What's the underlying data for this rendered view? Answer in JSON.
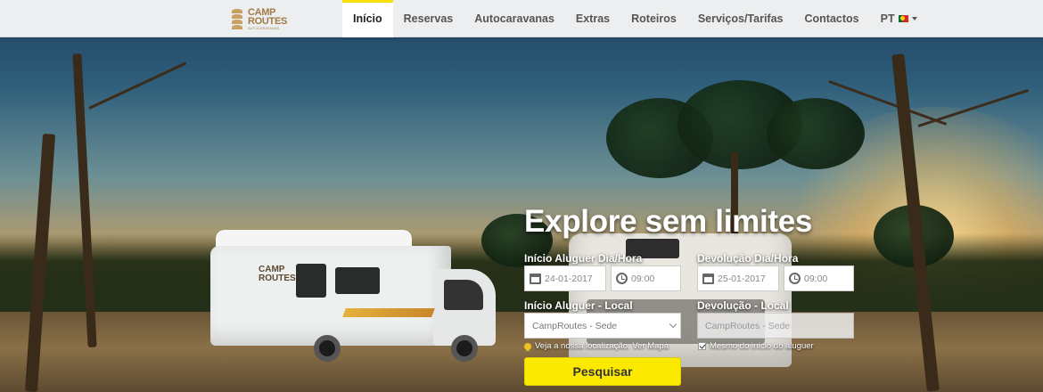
{
  "brand": {
    "name_line1": "CAMP",
    "name_line2": "ROUTES",
    "tagline": "AUTOCARAVANAS"
  },
  "nav": {
    "items": [
      {
        "label": "Início",
        "active": true
      },
      {
        "label": "Reservas"
      },
      {
        "label": "Autocaravanas"
      },
      {
        "label": "Extras"
      },
      {
        "label": "Roteiros"
      },
      {
        "label": "Serviços/Tarifas"
      },
      {
        "label": "Contactos"
      }
    ],
    "language": "PT"
  },
  "hero": {
    "headline": "Explore sem limites",
    "camper_logo_1": "CAMP",
    "camper_logo_2": "ROUTES"
  },
  "search": {
    "start_label": "Início Aluguer Dia/Hora",
    "start_date": "24-01-2017",
    "start_time": "09:00",
    "return_label": "Devolução Dia/Hora",
    "return_date": "25-01-2017",
    "return_time": "09:00",
    "start_location_label": "Início Aluguer - Local",
    "start_location": "CampRoutes - Sede",
    "return_location_label": "Devolução - Local",
    "return_location": "CampRoutes - Sede",
    "location_note": "Veja a nossa localização.",
    "map_link": "Ver Mapa",
    "same_as_start": "Mesmo do início do aluguer",
    "submit": "Pesquisar",
    "accent_color": "#FCE900"
  }
}
